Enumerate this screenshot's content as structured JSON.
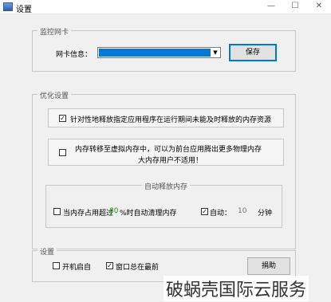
{
  "window": {
    "title": "设置",
    "controls": {
      "minimize": "—",
      "maximize": "☐",
      "close": "✕"
    }
  },
  "monitor_card": {
    "legend": "监控网卡",
    "nic_label": "网卡信息：",
    "nic_selected": "",
    "save_button": "保存"
  },
  "optimize": {
    "legend": "优化设置",
    "option1": {
      "checked": true,
      "label": "针对性地释放指定应用程序在运行期间未能及时释放的内存资源"
    },
    "option2": {
      "checked": false,
      "line1": "内存转移至虚拟内存中，可以为前台应用腾出更多物理内存",
      "line2": "大内存用户不适用！"
    },
    "auto_release": {
      "legend": "自动释放内存",
      "threshold_checked": false,
      "threshold_prefix": "当内存占用超过",
      "threshold_value": "80",
      "threshold_suffix": "%时自动清理内存",
      "auto_checked": true,
      "auto_label": "自动：",
      "interval_value": "10",
      "interval_unit": "分钟"
    }
  },
  "settings": {
    "legend": "设置",
    "startup_checked": false,
    "startup_label": "开机启自",
    "topmost_checked": true,
    "topmost_label": "窗口总在最前",
    "donate_button": "捐助"
  },
  "watermark": "破蜗壳国际云服务"
}
